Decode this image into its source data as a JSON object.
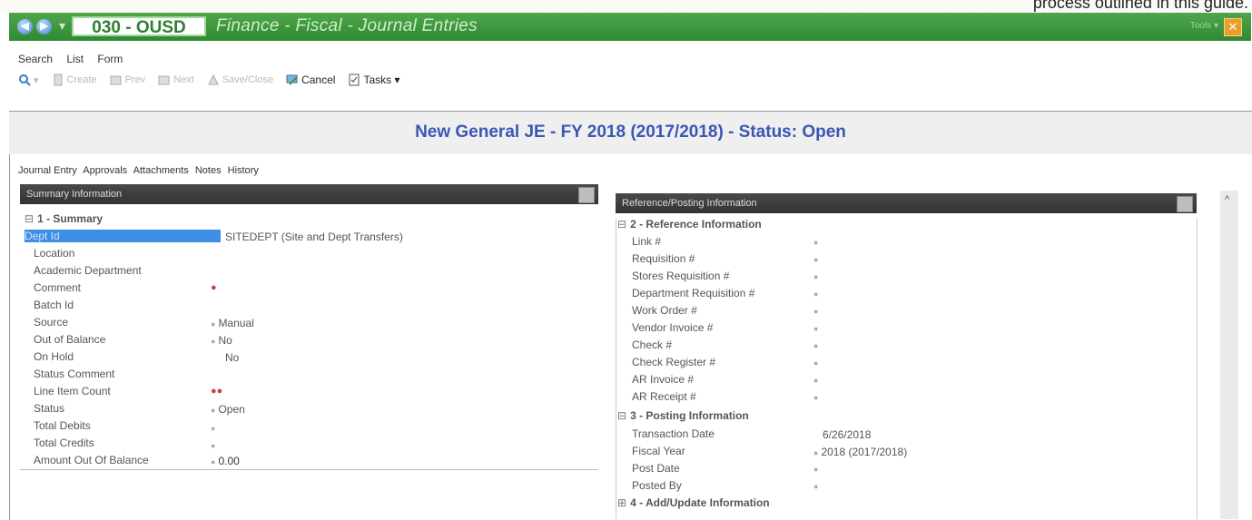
{
  "doc_caption": "process outlined in this guide.",
  "titlebar": {
    "district_code": "030 - OUSD",
    "module_path": "Finance - Fiscal - Journal Entries",
    "tools_label": "Tools"
  },
  "menu": [
    "Search",
    "List",
    "Form"
  ],
  "toolbar": {
    "create": "Create",
    "prev": "Prev",
    "next": "Next",
    "save_close": "Save/Close",
    "cancel": "Cancel",
    "tasks": "Tasks"
  },
  "form_title": "New General JE - FY 2018 (2017/2018) - Status: Open",
  "tabs": [
    "Journal Entry",
    "Approvals",
    "Attachments",
    "Notes",
    "History"
  ],
  "summary_panel": {
    "header": "Summary Information",
    "group": "1 - Summary",
    "rows": [
      {
        "label": "Dept Id",
        "value": "SITEDEPT (Site and Dept Transfers)"
      },
      {
        "label": "Location",
        "value": ""
      },
      {
        "label": "Academic Department",
        "value": ""
      },
      {
        "label": "Comment",
        "value": ""
      },
      {
        "label": "Batch Id",
        "value": ""
      },
      {
        "label": "Source",
        "value": "Manual"
      },
      {
        "label": "Out of Balance",
        "value": "No"
      },
      {
        "label": "On Hold",
        "value": "No"
      },
      {
        "label": "Status Comment",
        "value": ""
      },
      {
        "label": "Line Item Count",
        "value": ""
      },
      {
        "label": "Status",
        "value": "Open"
      },
      {
        "label": "Total Debits",
        "value": ""
      },
      {
        "label": "Total Credits",
        "value": ""
      },
      {
        "label": "Amount Out Of Balance",
        "value": "0.00"
      }
    ]
  },
  "reference_panel": {
    "header": "Reference/Posting Information",
    "group_reference": "2 - Reference Information",
    "reference_rows": [
      "Link #",
      "Requisition #",
      "Stores Requisition #",
      "Department Requisition #",
      "Work Order #",
      "Vendor Invoice #",
      "Check #",
      "Check Register #",
      "AR Invoice #",
      "AR Receipt #"
    ],
    "group_posting": "3 - Posting Information",
    "posting_rows": [
      {
        "label": "Transaction Date",
        "value": "6/26/2018"
      },
      {
        "label": "Fiscal Year",
        "value": "2018 (2017/2018)"
      },
      {
        "label": "Post Date",
        "value": ""
      },
      {
        "label": "Posted By",
        "value": ""
      }
    ],
    "group_add_update": "4 - Add/Update Information"
  },
  "colors": {
    "titlebar": "#2f8a33",
    "accent": "#3a57b5",
    "selected": "#3d8ee6"
  }
}
